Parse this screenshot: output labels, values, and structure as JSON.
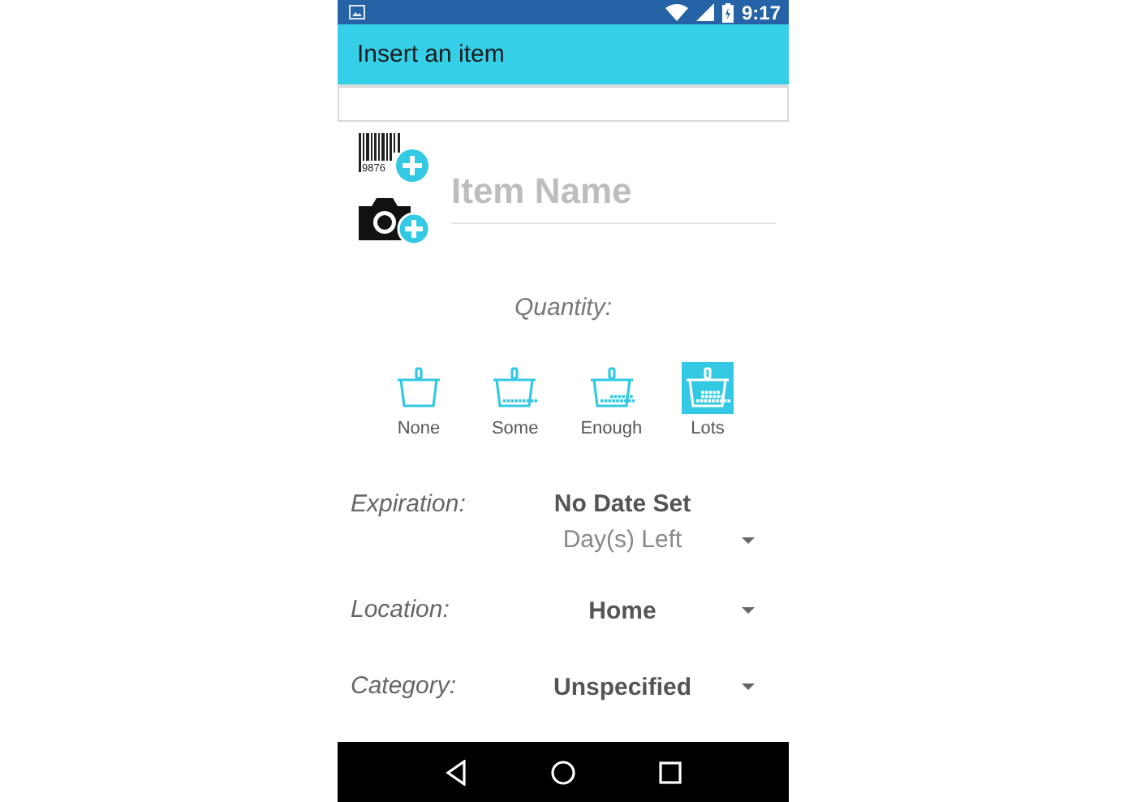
{
  "status_bar": {
    "time": "9:17"
  },
  "app_bar": {
    "title": "Insert an item"
  },
  "barcode_digits": "9876",
  "item_name": {
    "placeholder": "Item Name"
  },
  "quantity": {
    "label": "Quantity:",
    "options": [
      {
        "label": "None",
        "kind": "none",
        "selected": false
      },
      {
        "label": "Some",
        "kind": "some",
        "selected": false
      },
      {
        "label": "Enough",
        "kind": "enough",
        "selected": false
      },
      {
        "label": "Lots",
        "kind": "lots",
        "selected": true
      }
    ]
  },
  "fields": [
    {
      "kind": "date",
      "label": "Expiration:",
      "value": "No Date Set",
      "dropdown": "Day(s) Left"
    },
    {
      "kind": "spinner",
      "label": "Location:",
      "dropdown": "Home"
    },
    {
      "kind": "spinner",
      "label": "Category:",
      "dropdown": "Unspecified"
    }
  ]
}
